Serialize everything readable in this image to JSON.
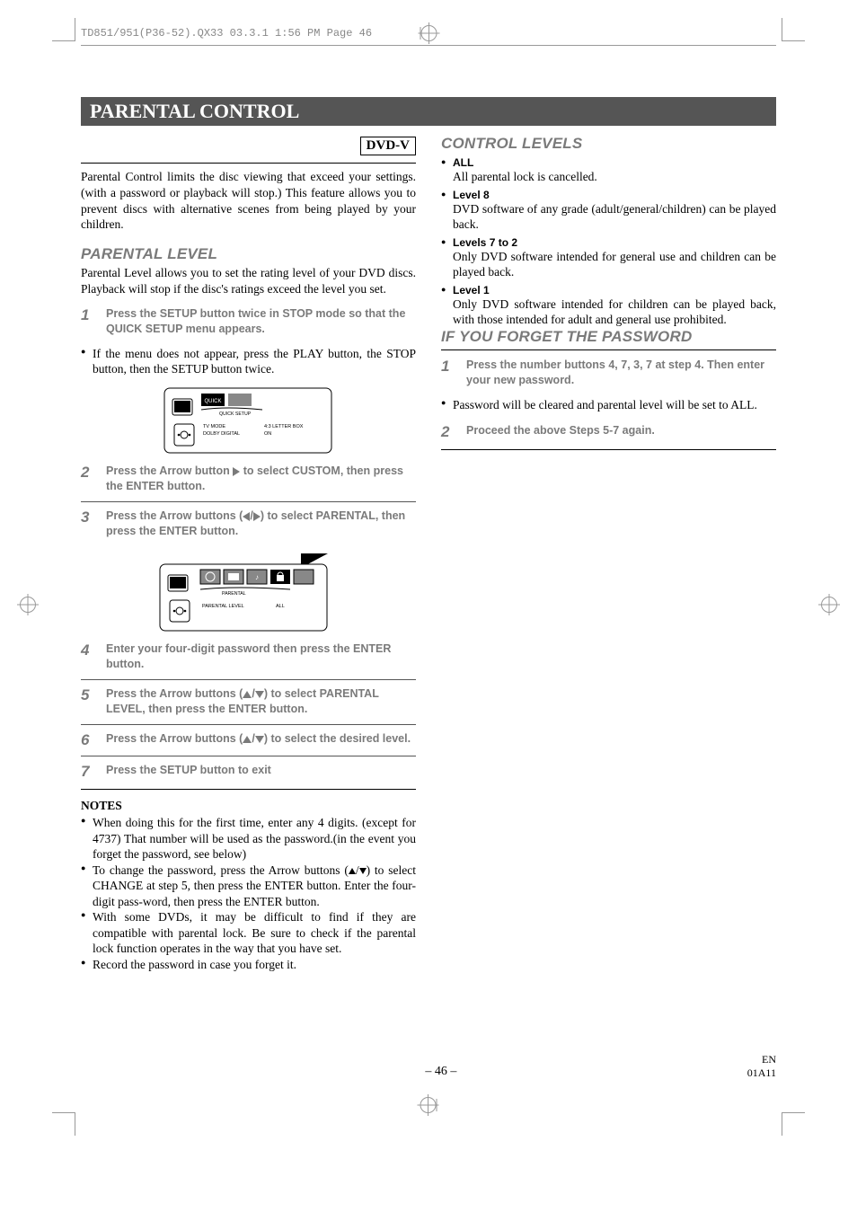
{
  "running_head": "TD851/951(P36-52).QX33  03.3.1 1:56 PM  Page 46",
  "title": "PARENTAL CONTROL",
  "dvd_badge": "DVD-V",
  "intro": "Parental Control limits the disc viewing that exceed your settings. (with a password or playback will stop.) This feature allows you to prevent discs with alternative scenes from being played by your children.",
  "parental_level_head": "PARENTAL LEVEL",
  "parental_level_body": "Parental Level allows you to set the rating level of your DVD discs. Playback will stop if the disc's ratings exceed the level you set.",
  "steps": [
    {
      "n": "1",
      "t": "Press the SETUP button twice in STOP mode so that the QUICK SETUP menu appears."
    },
    {
      "n": "2",
      "t": "Press the Arrow button ▶ to select CUSTOM, then press the ENTER button."
    },
    {
      "n": "3",
      "t": "Press the Arrow buttons (◀/▶) to select PARENTAL, then press the ENTER button."
    },
    {
      "n": "4",
      "t": "Enter your four-digit password then press the ENTER button."
    },
    {
      "n": "5",
      "t": "Press the Arrow buttons (▲/▼) to select PARENTAL LEVEL, then press the ENTER button."
    },
    {
      "n": "6",
      "t": "Press the Arrow buttons (▲/▼) to select the desired level."
    },
    {
      "n": "7",
      "t": "Press the SETUP button to exit"
    }
  ],
  "after_step1_bullet": "If the menu does not appear, press the PLAY button, the STOP button, then the SETUP button twice.",
  "notes_head": "NOTES",
  "notes": [
    "When doing this for the first time, enter any 4 digits. (except for 4737) That number will be used as the password.(in the event you forget the password, see below)",
    "To change the password, press the Arrow buttons (▲/▼) to select CHANGE at step 5, then press the ENTER button. Enter the four-digit pass-word, then press the ENTER button.",
    "With some DVDs, it may be difficult to find if they are compatible with parental lock. Be sure to check if the parental lock function operates in the way that you have set.",
    "Record the password in case you forget it."
  ],
  "control_levels_head": "CONTROL LEVELS",
  "control_levels": [
    {
      "h": "ALL",
      "b": "All parental lock is cancelled."
    },
    {
      "h": "Level 8",
      "b": "DVD software of any grade (adult/general/children) can be played back."
    },
    {
      "h": "Levels 7 to 2",
      "b": "Only DVD software intended for general use and children can be played back."
    },
    {
      "h": "Level 1",
      "b": "Only DVD software intended for children can be played back, with those intended for adult and general use prohibited."
    }
  ],
  "forgot_head": "IF YOU FORGET THE PASSWORD",
  "forgot_steps": [
    {
      "n": "1",
      "t": "Press the number buttons 4, 7, 3, 7 at step 4. Then enter your new password."
    },
    {
      "n": "2",
      "t": "Proceed the above Steps 5-7 again."
    }
  ],
  "forgot_bullet": "Password will be cleared and parental level will be set to ALL.",
  "osd1": {
    "tab": "QUICK SETUP",
    "rows": [
      [
        "TV MODE",
        "4:3 LETTER BOX"
      ],
      [
        "DOLBY DIGITAL",
        "ON"
      ]
    ]
  },
  "osd2": {
    "tab": "PARENTAL",
    "rows": [
      [
        "PARENTAL LEVEL",
        "ALL"
      ]
    ]
  },
  "page_number": "– 46 –",
  "footer_code_top": "EN",
  "footer_code_bot": "01A11"
}
